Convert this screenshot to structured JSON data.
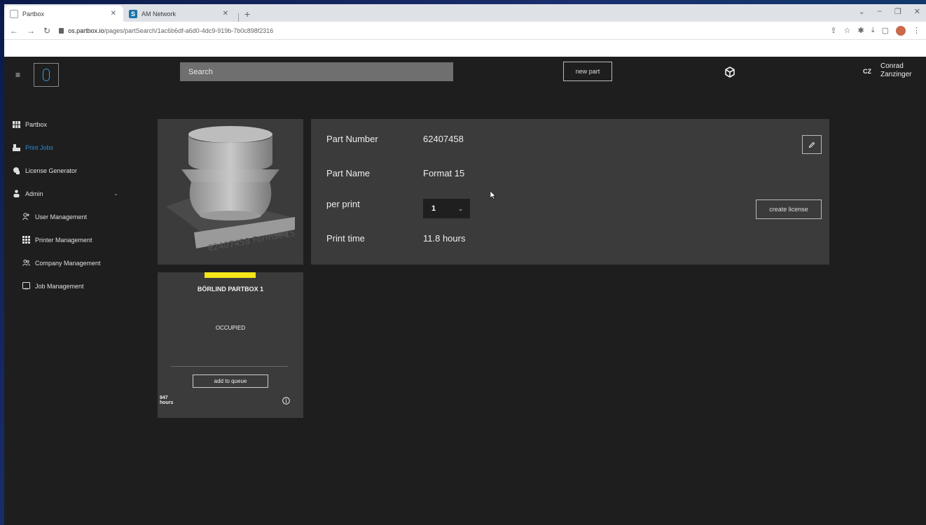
{
  "browser": {
    "tabs": [
      {
        "label": "Partbox",
        "active": true
      },
      {
        "label": "AM Network",
        "active": false,
        "favicon_letter": "S"
      }
    ],
    "url_host": "os.partbox.io",
    "url_path": "/pages/partSearch/1ac6b6df-a6d0-4dc9-919b-7b0c898f2316"
  },
  "header": {
    "search_placeholder": "Search",
    "new_part_label": "new part",
    "user_initials": "CZ",
    "user_first": "Conrad",
    "user_last": "Zanzinger"
  },
  "sidebar": {
    "items": [
      {
        "label": "Partbox",
        "icon": "grid-box-icon"
      },
      {
        "label": "Print Jobs",
        "icon": "printer-icon",
        "active": true
      },
      {
        "label": "License Generator",
        "icon": "license-icon"
      },
      {
        "label": "Admin",
        "icon": "person-icon"
      },
      {
        "label": "User Management",
        "icon": "user-add-icon"
      },
      {
        "label": "Printer Management",
        "icon": "grid-icon"
      },
      {
        "label": "Company Management",
        "icon": "users-icon"
      },
      {
        "label": "Job Management",
        "icon": "tablet-icon"
      }
    ]
  },
  "part": {
    "image_caption": "62407458 Format 15",
    "labels": {
      "number": "Part Number",
      "name": "Part Name",
      "per_print": "per print",
      "print_time": "Print time"
    },
    "number": "62407458",
    "name": "Format 15",
    "per_print_value": "1",
    "print_time": "11.8 hours",
    "create_license_label": "create license"
  },
  "printer": {
    "name": "BÖRLIND PARTBOX 1",
    "status": "OCCUPIED",
    "status_color": "#f6e61a",
    "queue_label": "add to queue",
    "hours_value": "947",
    "hours_unit": "hours"
  }
}
